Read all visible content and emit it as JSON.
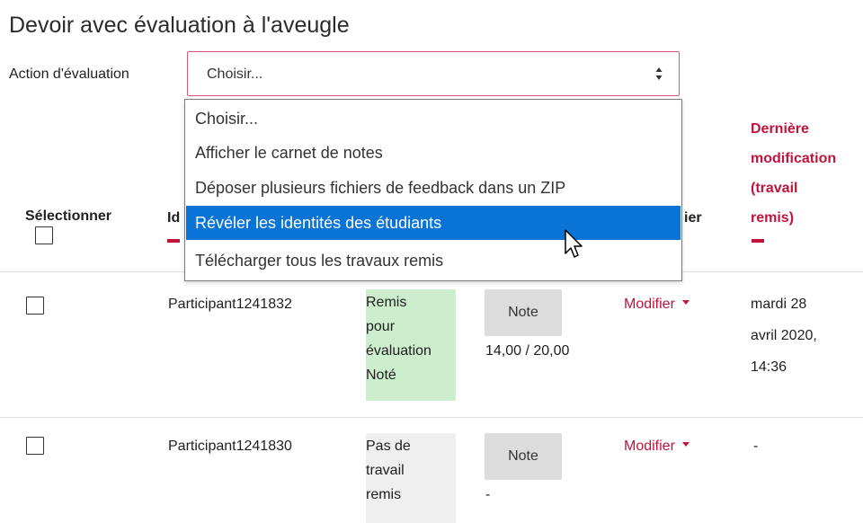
{
  "page": {
    "title": "Devoir avec évaluation à l'aveugle"
  },
  "grading_action": {
    "label": "Action d'évaluation",
    "selected": "Choisir...",
    "options": [
      "Choisir...",
      "Afficher le carnet de notes",
      "Déposer plusieurs fichiers de feedback dans un ZIP",
      "Révéler les identités des étudiants",
      "Télécharger tous les travaux remis"
    ],
    "highlighted_index": 3
  },
  "table": {
    "headers": {
      "select": "Sélectionner",
      "identity_partial": "Id",
      "edit_partial": "ier",
      "last_modified_line1": "Dernière",
      "last_modified_line2": "modification",
      "last_modified_line3": "(travail",
      "last_modified_line4": "remis)"
    },
    "rows": [
      {
        "participant": "Participant1241832",
        "status_lines": [
          "Remis",
          "pour",
          "évaluation",
          "Noté"
        ],
        "grade_button": "Note",
        "grade_value": "14,00 / 20,00",
        "edit_label": "Modifier",
        "modified_lines": [
          "mardi 28",
          "avril 2020,",
          "14:36"
        ]
      },
      {
        "participant": "Participant1241830",
        "status_lines": [
          "Pas de",
          "travail",
          "remis"
        ],
        "grade_button": "Note",
        "grade_value": "-",
        "edit_label": "Modifier",
        "modified_lines": [
          "-"
        ]
      }
    ]
  },
  "colors": {
    "accent": "#c0143c",
    "highlight": "#0a74d6",
    "status_submitted": "#cdeecd",
    "status_none": "#efefef"
  },
  "icons": {
    "select_arrows": "sort-arrows-icon",
    "cursor": "mouse-pointer-icon",
    "caret": "caret-down-icon"
  }
}
